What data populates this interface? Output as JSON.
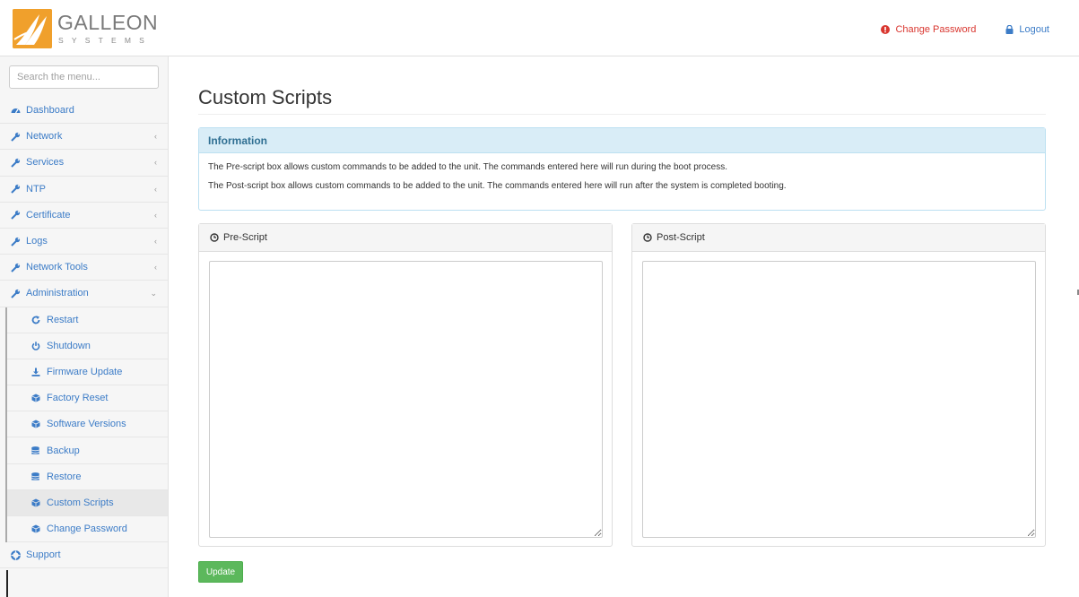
{
  "brand": {
    "name": "GALLEON",
    "sub": "SYSTEMS"
  },
  "header": {
    "change_password": "Change Password",
    "logout": "Logout",
    "colors": {
      "change_password": "#d9362f",
      "logout": "#3c7cc7"
    }
  },
  "sidebar": {
    "search_placeholder": "Search the menu...",
    "items": [
      {
        "label": "Dashboard",
        "icon": "dashboard-icon"
      },
      {
        "label": "Network",
        "icon": "wrench-icon"
      },
      {
        "label": "Services",
        "icon": "wrench-icon"
      },
      {
        "label": "NTP",
        "icon": "wrench-icon"
      },
      {
        "label": "Certificate",
        "icon": "wrench-icon"
      },
      {
        "label": "Logs",
        "icon": "wrench-icon"
      },
      {
        "label": "Network Tools",
        "icon": "wrench-icon"
      },
      {
        "label": "Administration",
        "icon": "wrench-icon"
      }
    ],
    "admin_items": [
      {
        "label": "Restart",
        "icon": "refresh-icon"
      },
      {
        "label": "Shutdown",
        "icon": "power-icon"
      },
      {
        "label": "Firmware Update",
        "icon": "download-icon"
      },
      {
        "label": "Factory Reset",
        "icon": "cube-icon"
      },
      {
        "label": "Software Versions",
        "icon": "cube-icon"
      },
      {
        "label": "Backup",
        "icon": "database-icon"
      },
      {
        "label": "Restore",
        "icon": "database-icon"
      },
      {
        "label": "Custom Scripts",
        "icon": "cube-icon"
      },
      {
        "label": "Change Password",
        "icon": "cube-icon"
      }
    ],
    "support": {
      "label": "Support",
      "icon": "lifebuoy-icon"
    },
    "active": "Custom Scripts"
  },
  "main": {
    "title": "Custom Scripts",
    "info": {
      "heading": "Information",
      "line1": "The Pre-script box allows custom commands to be added to the unit. The commands entered here will run during the boot process.",
      "line2": "The Post-script box allows custom commands to be added to the unit. The commands entered here will run after the system is completed booting."
    },
    "pre_script": {
      "heading": "Pre-Script",
      "value": ""
    },
    "post_script": {
      "heading": "Post-Script",
      "value": ""
    },
    "update_label": "Update",
    "colors": {
      "accent": "#3c7cc7",
      "update": "#5cb85c",
      "info_bg": "#d9edf7"
    }
  }
}
